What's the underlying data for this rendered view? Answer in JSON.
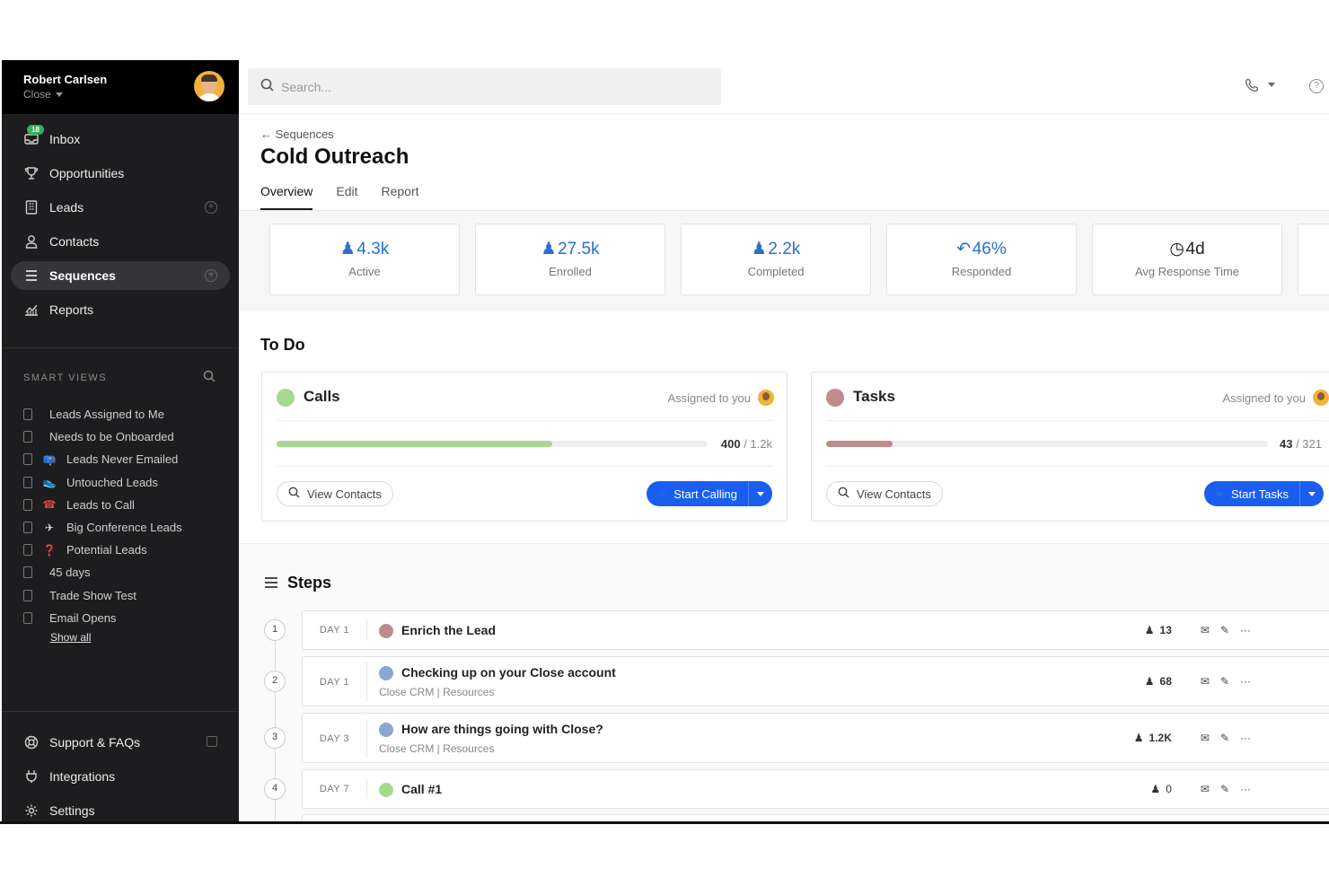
{
  "user": {
    "name": "Robert Carlsen",
    "org": "Close"
  },
  "nav": {
    "inbox": {
      "label": "Inbox",
      "badge": "18"
    },
    "items": [
      {
        "label": "Opportunities"
      },
      {
        "label": "Leads"
      },
      {
        "label": "Contacts"
      },
      {
        "label": "Sequences"
      },
      {
        "label": "Reports"
      }
    ]
  },
  "smart_views": {
    "title": "SMART VIEWS",
    "items": [
      {
        "label": "Leads Assigned to Me",
        "emoji": ""
      },
      {
        "label": "Needs to be Onboarded",
        "emoji": ""
      },
      {
        "label": "Leads Never Emailed",
        "emoji": "📪"
      },
      {
        "label": "Untouched Leads",
        "emoji": "👟"
      },
      {
        "label": "Leads to Call",
        "emoji": "☎"
      },
      {
        "label": "Big Conference Leads",
        "emoji": "✈"
      },
      {
        "label": "Potential Leads",
        "emoji": "❓"
      },
      {
        "label": "45 days",
        "emoji": ""
      },
      {
        "label": "Trade Show Test",
        "emoji": ""
      },
      {
        "label": "Email Opens",
        "emoji": ""
      }
    ],
    "show_all": "Show all"
  },
  "bottom_nav": [
    {
      "label": "Support & FAQs"
    },
    {
      "label": "Integrations"
    },
    {
      "label": "Settings"
    }
  ],
  "search": {
    "placeholder": "Search..."
  },
  "breadcrumb": "Sequences",
  "page_title": "Cold Outreach",
  "tabs": [
    "Overview",
    "Edit",
    "Report"
  ],
  "stats": [
    {
      "value": "4.3k",
      "label": "Active",
      "icon": "person-icon"
    },
    {
      "value": "27.5k",
      "label": "Enrolled",
      "icon": "person-icon"
    },
    {
      "value": "2.2k",
      "label": "Completed",
      "icon": "person-icon"
    },
    {
      "value": "46%",
      "label": "Responded",
      "icon": "reply-icon"
    },
    {
      "value": "4d",
      "label": "Avg Response Time",
      "icon": "clock-icon"
    }
  ],
  "todo": {
    "title": "To Do",
    "calls": {
      "title": "Calls",
      "assigned": "Assigned to you",
      "done": "400",
      "total": "/ 1.2k",
      "progress": 0.64,
      "view": "View Contacts",
      "action": "Start Calling",
      "color": "#a7d890"
    },
    "tasks": {
      "title": "Tasks",
      "assigned": "Assigned to you",
      "done": "43",
      "total": "/ 321",
      "progress": 0.15,
      "view": "View Contacts",
      "action": "Start Tasks",
      "color": "#c08b8b"
    }
  },
  "steps": {
    "title": "Steps",
    "items": [
      {
        "num": "1",
        "day": "DAY 1",
        "name": "Enrich the Lead",
        "sub": "",
        "count": "13",
        "type": "task"
      },
      {
        "num": "2",
        "day": "DAY 1",
        "name": "Checking up on your Close account",
        "sub": "Close CRM | Resources",
        "count": "68",
        "type": "email"
      },
      {
        "num": "3",
        "day": "DAY 3",
        "name": "How are things going with Close?",
        "sub": "Close CRM | Resources",
        "count": "1.2K",
        "type": "email"
      },
      {
        "num": "4",
        "day": "DAY 7",
        "name": "Call #1",
        "sub": "",
        "count": "0",
        "type": "call"
      }
    ]
  },
  "colors": {
    "accent": "#1a5ef0",
    "stat": "#2b6fcf",
    "call": "#a7d890",
    "task": "#c08b8b",
    "email": "#8aa8cf"
  }
}
